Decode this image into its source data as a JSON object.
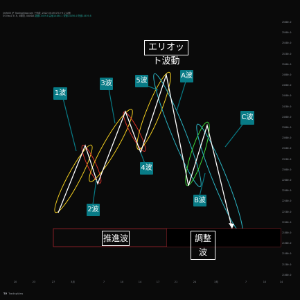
{
  "header": {
    "line": "jimfe05 が TradingView.com で作成, 2022 05:49 UTC+9 に公開",
    "symbol": "US Nas1 5l 3l, 4時間, OANDA",
    "ohlc": "始値14459.8  高値14480.1  安値14456.4  終値14459.8"
  },
  "title": "エリオット波動",
  "labels": {
    "w1": "1波",
    "w2": "2波",
    "w3": "3波",
    "w4": "4波",
    "w5": "5波",
    "wa": "A波",
    "wb": "B波",
    "wc": "C波"
  },
  "bottom_boxes": {
    "impulse": "推進波",
    "corrective": "調整波"
  },
  "yaxis": {
    "ticks": [
      "25800.0",
      "25600.0",
      "25400.0",
      "25200.0",
      "25000.0",
      "24800.0",
      "24600.0",
      "24400.0",
      "24200.0",
      "24000.0",
      "23800.0",
      "23600.0",
      "23400.0",
      "23200.0",
      "23000.0",
      "22800.0",
      "22600.0",
      "22400.0",
      "22200.0",
      "22000.0",
      "21800.0",
      "21600.0",
      "21400.0",
      "21200.0",
      "21000.0"
    ]
  },
  "xaxis": {
    "ticks": [
      "20",
      "23",
      "27",
      "3月",
      "7",
      "10",
      "14",
      "17",
      "21",
      "24",
      "3月",
      "7",
      "10",
      "14"
    ]
  },
  "footer": {
    "logo": "TV",
    "brand": "TradingView"
  },
  "colors": {
    "background": "#0a0a0a",
    "wave_line": "#ffffff",
    "impulse_ellipse": "#f5d020",
    "correction_red": "#e0332a",
    "corrective_green": "#3ddc3a",
    "corrective_cyan": "#2bb5c4",
    "badge": "#087b86"
  }
}
